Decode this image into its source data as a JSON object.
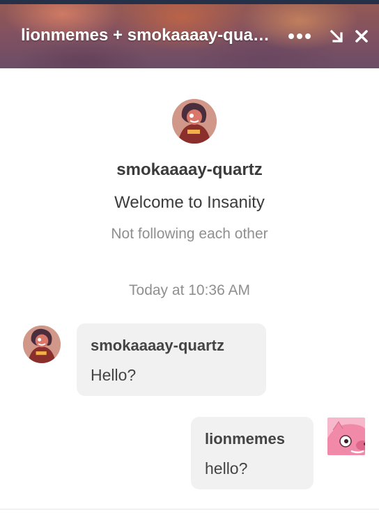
{
  "header": {
    "title": "lionmemes + smokaaaay-quartz",
    "icons": [
      "more-icon",
      "minimize-icon",
      "close-icon"
    ]
  },
  "profile": {
    "name": "smokaaaay-quartz",
    "blog_title": "Welcome to Insanity",
    "follow_status": "Not following each other"
  },
  "timestamp": "Today at 10:36 AM",
  "messages": [
    {
      "sender": "smokaaaay-quartz",
      "text": "Hello?",
      "side": "left"
    },
    {
      "sender": "lionmemes",
      "text": "hello?",
      "side": "right"
    }
  ],
  "colors": {
    "header_bg": "#9a6070",
    "bubble_bg": "#f1f1f1",
    "text_dark": "#3b3b3b",
    "text_muted": "#8f8f8f"
  }
}
